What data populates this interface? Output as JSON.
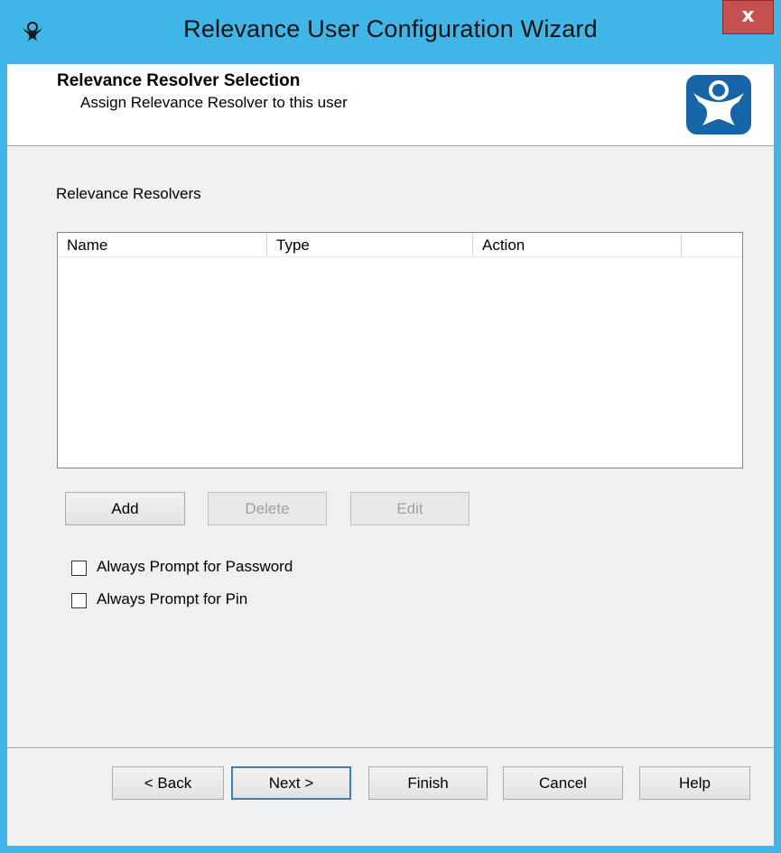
{
  "window": {
    "title": "Relevance User Configuration Wizard",
    "close_label": "x"
  },
  "header": {
    "title": "Relevance Resolver Selection",
    "subtitle": "Assign Relevance Resolver to this user"
  },
  "resolvers": {
    "label": "Relevance Resolvers",
    "columns": [
      "Name",
      "Type",
      "Action",
      ""
    ],
    "rows": []
  },
  "list_buttons": {
    "add": "Add",
    "delete": "Delete",
    "edit": "Edit"
  },
  "options": [
    {
      "label": "Always Prompt for Password",
      "checked": false
    },
    {
      "label": "Always Prompt for Pin",
      "checked": false
    }
  ],
  "footer": {
    "back": "< Back",
    "next": "Next >",
    "finish": "Finish",
    "cancel": "Cancel",
    "help": "Help"
  },
  "colors": {
    "accent": "#40b5e8",
    "close": "#c75050",
    "logo": "#1565a8"
  },
  "icons": {
    "app": "thinman-logo-icon",
    "header": "thinman-logo-icon",
    "close": "close-icon"
  }
}
